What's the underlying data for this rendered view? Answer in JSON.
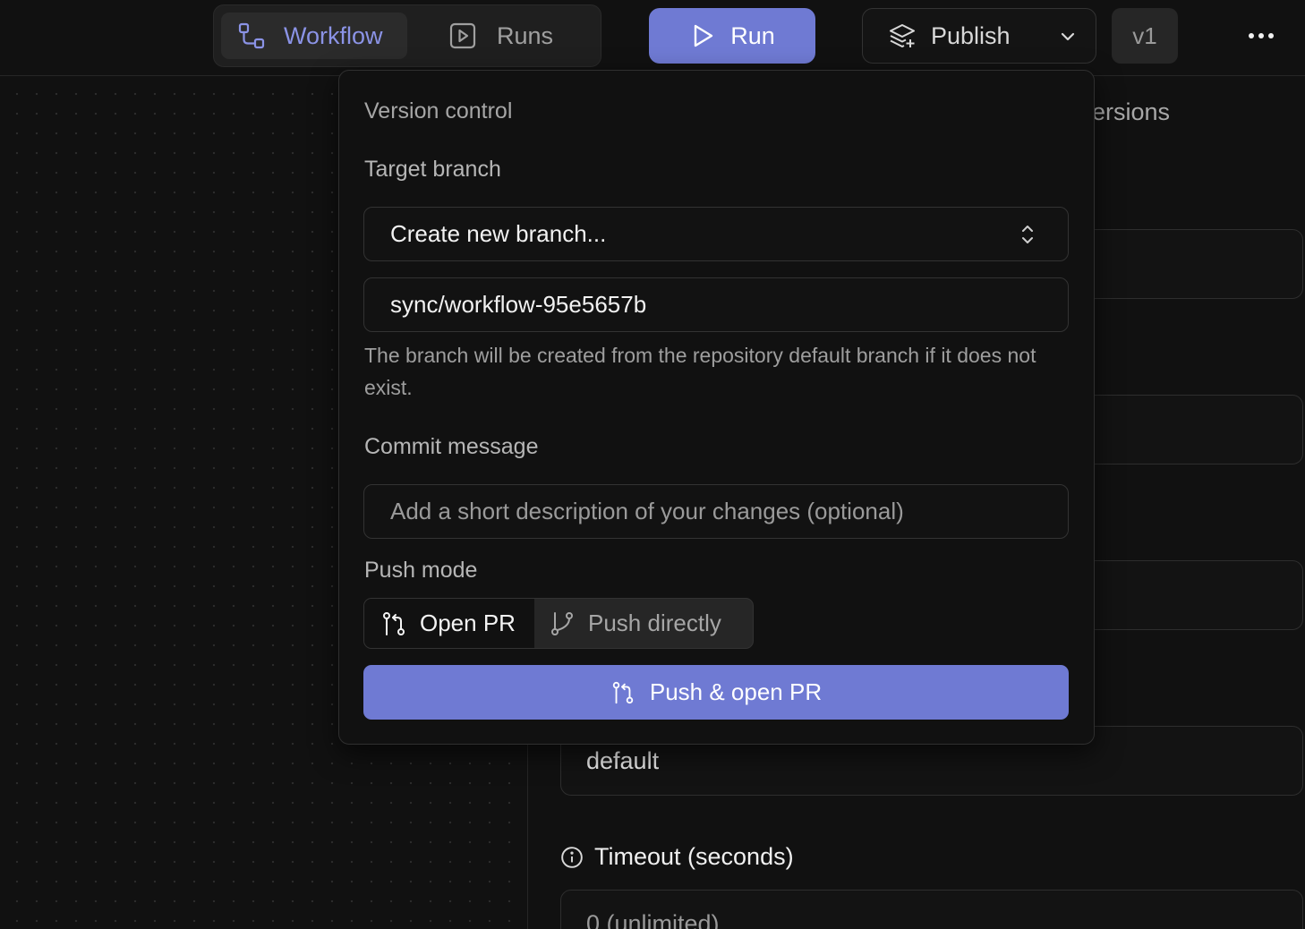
{
  "topbar": {
    "view_toggle": {
      "workflow_label": "Workflow",
      "runs_label": "Runs",
      "active": "Workflow"
    },
    "run_label": "Run",
    "publish_label": "Publish",
    "version_badge": "v1"
  },
  "right_panel": {
    "tab_label": "ersions",
    "fields": [
      "",
      "",
      "",
      "default"
    ],
    "timeout_label": "Timeout (seconds)",
    "timeout_value": "0 (unlimited)"
  },
  "popover": {
    "title": "Version control",
    "target_branch_label": "Target branch",
    "branch_select_value": "Create new branch...",
    "branch_name_value": "sync/workflow-95e5657b",
    "branch_help": "The branch will be created from the repository default branch if it does not exist.",
    "commit_message_label": "Commit message",
    "commit_message_placeholder": "Add a short description of your changes (optional)",
    "push_mode_label": "Push mode",
    "push_mode_options": [
      "Open PR",
      "Push directly"
    ],
    "push_mode_selected": "Open PR",
    "submit_label": "Push & open PR"
  },
  "colors": {
    "accent": "#6f7ad3",
    "accent_text": "#8b93e6",
    "background": "#111111"
  }
}
